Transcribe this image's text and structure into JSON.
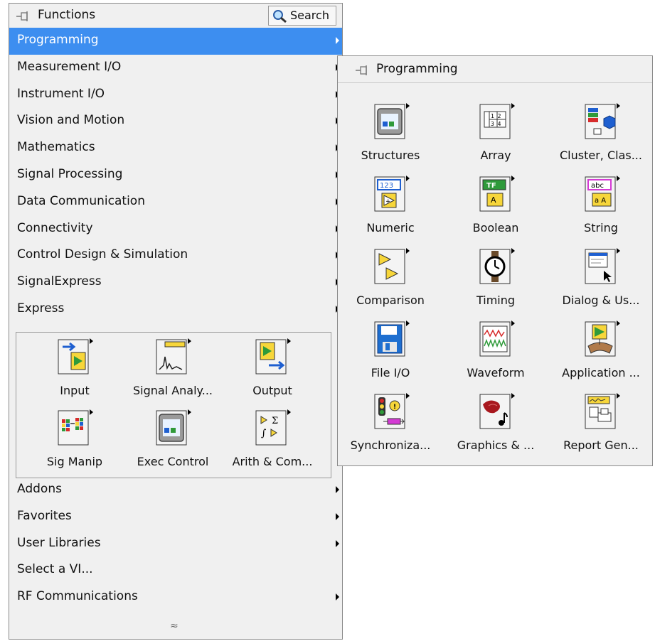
{
  "palette": {
    "title": "Functions",
    "search_label": "Search",
    "menu_items": [
      {
        "label": "Programming",
        "has_submenu": true,
        "selected": true
      },
      {
        "label": "Measurement I/O",
        "has_submenu": true
      },
      {
        "label": "Instrument I/O",
        "has_submenu": true
      },
      {
        "label": "Vision and Motion",
        "has_submenu": true
      },
      {
        "label": "Mathematics",
        "has_submenu": true
      },
      {
        "label": "Signal Processing",
        "has_submenu": true
      },
      {
        "label": "Data Communication",
        "has_submenu": true
      },
      {
        "label": "Connectivity",
        "has_submenu": true
      },
      {
        "label": "Control Design & Simulation",
        "has_submenu": true
      },
      {
        "label": "SignalExpress",
        "has_submenu": true
      },
      {
        "label": "Express",
        "has_submenu": true
      }
    ],
    "express_items": [
      {
        "label": "Input",
        "icon": "express-input-icon"
      },
      {
        "label": "Signal Analy...",
        "icon": "signal-analysis-icon"
      },
      {
        "label": "Output",
        "icon": "express-output-icon"
      },
      {
        "label": "Sig Manip",
        "icon": "sig-manip-icon"
      },
      {
        "label": "Exec Control",
        "icon": "exec-control-icon"
      },
      {
        "label": "Arith & Com...",
        "icon": "arith-compare-icon"
      }
    ],
    "bottom_items": [
      {
        "label": "Addons",
        "has_submenu": true
      },
      {
        "label": "Favorites",
        "has_submenu": true
      },
      {
        "label": "User Libraries",
        "has_submenu": true
      },
      {
        "label": "Select a VI...",
        "has_submenu": false
      },
      {
        "label": "RF Communications",
        "has_submenu": true
      }
    ],
    "collapse_glyph": "≈"
  },
  "submenu": {
    "title": "Programming",
    "items": [
      {
        "label": "Structures",
        "icon": "structures-icon"
      },
      {
        "label": "Array",
        "icon": "array-icon"
      },
      {
        "label": "Cluster, Clas...",
        "icon": "cluster-icon"
      },
      {
        "label": "Numeric",
        "icon": "numeric-icon"
      },
      {
        "label": "Boolean",
        "icon": "boolean-icon"
      },
      {
        "label": "String",
        "icon": "string-icon"
      },
      {
        "label": "Comparison",
        "icon": "comparison-icon"
      },
      {
        "label": "Timing",
        "icon": "timing-icon"
      },
      {
        "label": "Dialog & Us...",
        "icon": "dialog-icon"
      },
      {
        "label": "File I/O",
        "icon": "file-io-icon"
      },
      {
        "label": "Waveform",
        "icon": "waveform-icon"
      },
      {
        "label": "Application ...",
        "icon": "application-control-icon"
      },
      {
        "label": "Synchroniza...",
        "icon": "synchronization-icon"
      },
      {
        "label": "Graphics & ...",
        "icon": "graphics-sound-icon"
      },
      {
        "label": "Report Gen...",
        "icon": "report-generation-icon"
      }
    ]
  },
  "colors": {
    "selection": "#3d8ef0",
    "background": "#f0f0f0"
  }
}
